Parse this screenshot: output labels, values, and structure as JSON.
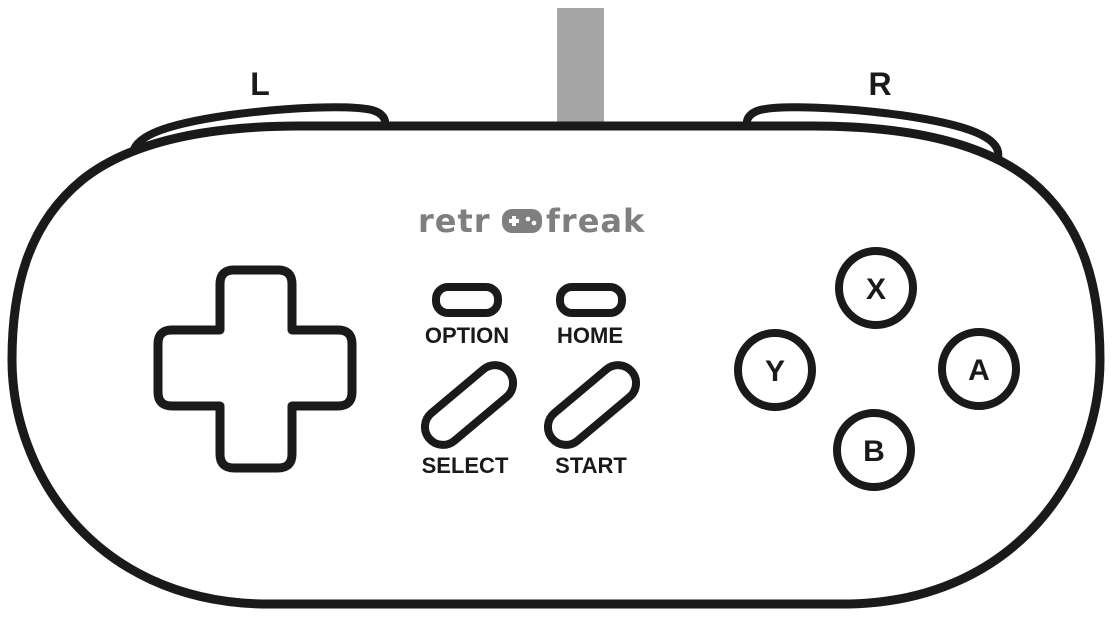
{
  "shoulder": {
    "left_label": "L",
    "right_label": "R"
  },
  "logo": {
    "part1": "retr",
    "part2": "freak",
    "color": "#7f7f7f"
  },
  "center": {
    "option_label": "OPTION",
    "home_label": "HOME",
    "select_label": "SELECT",
    "start_label": "START"
  },
  "face_buttons": {
    "x": "X",
    "y": "Y",
    "a": "A",
    "b": "B"
  },
  "colors": {
    "outline": "#1a1a1a",
    "cable": "#a6a6a6",
    "fill": "#ffffff"
  },
  "icons": {
    "dpad": "dpad-icon",
    "logo_pad": "gamepad-icon"
  }
}
